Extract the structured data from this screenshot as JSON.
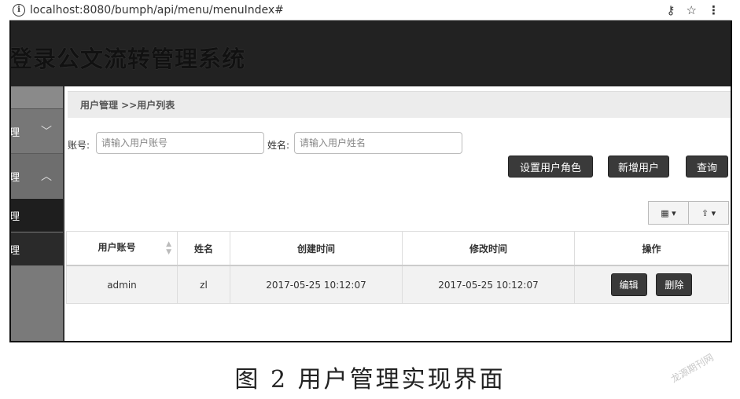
{
  "browser": {
    "url": "localhost:8080/bumph/api/menu/menuIndex#",
    "info_icon": "i",
    "icons": [
      "key-icon",
      "star-icon",
      "menu-icon"
    ]
  },
  "header": {
    "title": "登录公文流转管理系统"
  },
  "sidebar": {
    "items": [
      {
        "label": "理",
        "chevron": "﹀"
      },
      {
        "label": "理",
        "chevron": "︿"
      },
      {
        "label": "理"
      },
      {
        "label": "理"
      }
    ]
  },
  "breadcrumb": "用户管理 >>用户列表",
  "search": {
    "account_label": "账号:",
    "account_placeholder": "请输入用户账号",
    "name_label": "姓名:",
    "name_placeholder": "请输入用户姓名"
  },
  "actions": {
    "set_role": "设置用户角色",
    "add_user": "新增用户",
    "query": "查询"
  },
  "toolbar": {
    "columns_icon": "▦ ▾",
    "export_icon": "⇪ ▾"
  },
  "table": {
    "columns": [
      "用户账号",
      "姓名",
      "创建时间",
      "修改时间",
      "操作"
    ],
    "rows": [
      {
        "account": "admin",
        "name": "zl",
        "created": "2017-05-25 10:12:07",
        "modified": "2017-05-25 10:12:07",
        "edit": "编辑",
        "delete": "删除"
      }
    ]
  },
  "caption": "图 2   用户管理实现界面",
  "watermark": "龙源期刊网"
}
